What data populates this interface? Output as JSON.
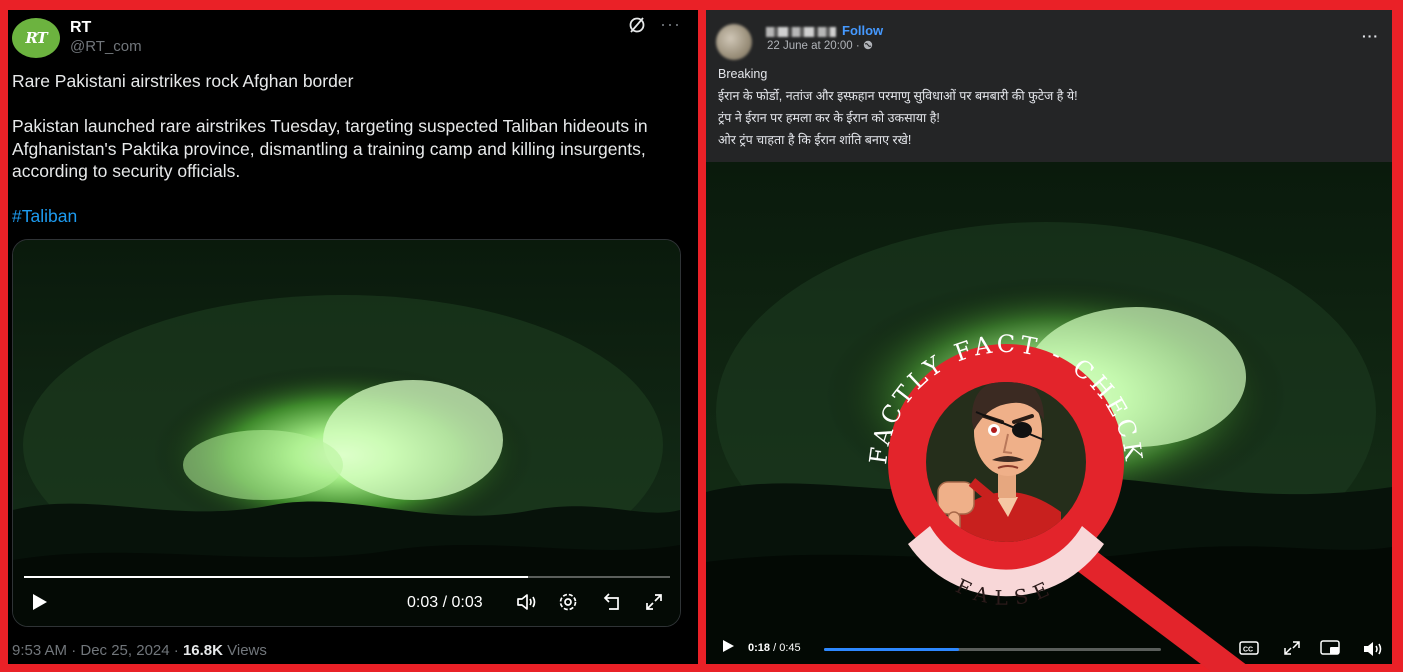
{
  "left_post": {
    "avatar_text": "RT",
    "name": "RT",
    "handle": "@RT_com",
    "headline": "Rare Pakistani airstrikes rock Afghan border",
    "body": "Pakistan launched rare airstrikes Tuesday, targeting suspected Taliban hideouts in Afghanistan's Paktika province, dismantling a training camp and killing insurgents, according to security officials.",
    "hashtag": "#Taliban",
    "video": {
      "time_display": "0:03 / 0:03",
      "progress_fraction": 0.78
    },
    "timestamp": "9:53 AM · Dec 25, 2024 · ",
    "views_count": "16.8K",
    "views_label": " Views",
    "icons": [
      "grok-icon",
      "more-icon",
      "play-icon",
      "volume-icon",
      "settings-icon",
      "minimize-icon",
      "fullscreen-icon"
    ]
  },
  "right_post": {
    "follow_label": "Follow",
    "date": "22 June at 20:00 · ",
    "lines": [
      "Breaking",
      "ईरान के फोर्डो, नतांज और इस्फ़हान परमाणु सुविधाओं पर बमबारी की फुटेज है ये!",
      "ट्रंप ने ईरान पर हमला कर के ईरान को उकसाया है!",
      "ओर ट्रंप चाहता है कि ईरान शांति बनाए रखे!"
    ],
    "video": {
      "time_current": "0:18",
      "time_total": "0:45",
      "time_separator": " / ",
      "progress_fraction": 0.4
    }
  },
  "stamp": {
    "ring_text": "FACTLY FACT - CHECK",
    "verdict": "FALSE",
    "ring_color": "#e3242b",
    "verdict_bg": "#f8d7d8"
  },
  "colors": {
    "background_frame": "#ea2127",
    "twitter_link": "#1d9bf0",
    "facebook_link": "#4599ff",
    "night_vision_green": "#7cfc6c"
  }
}
